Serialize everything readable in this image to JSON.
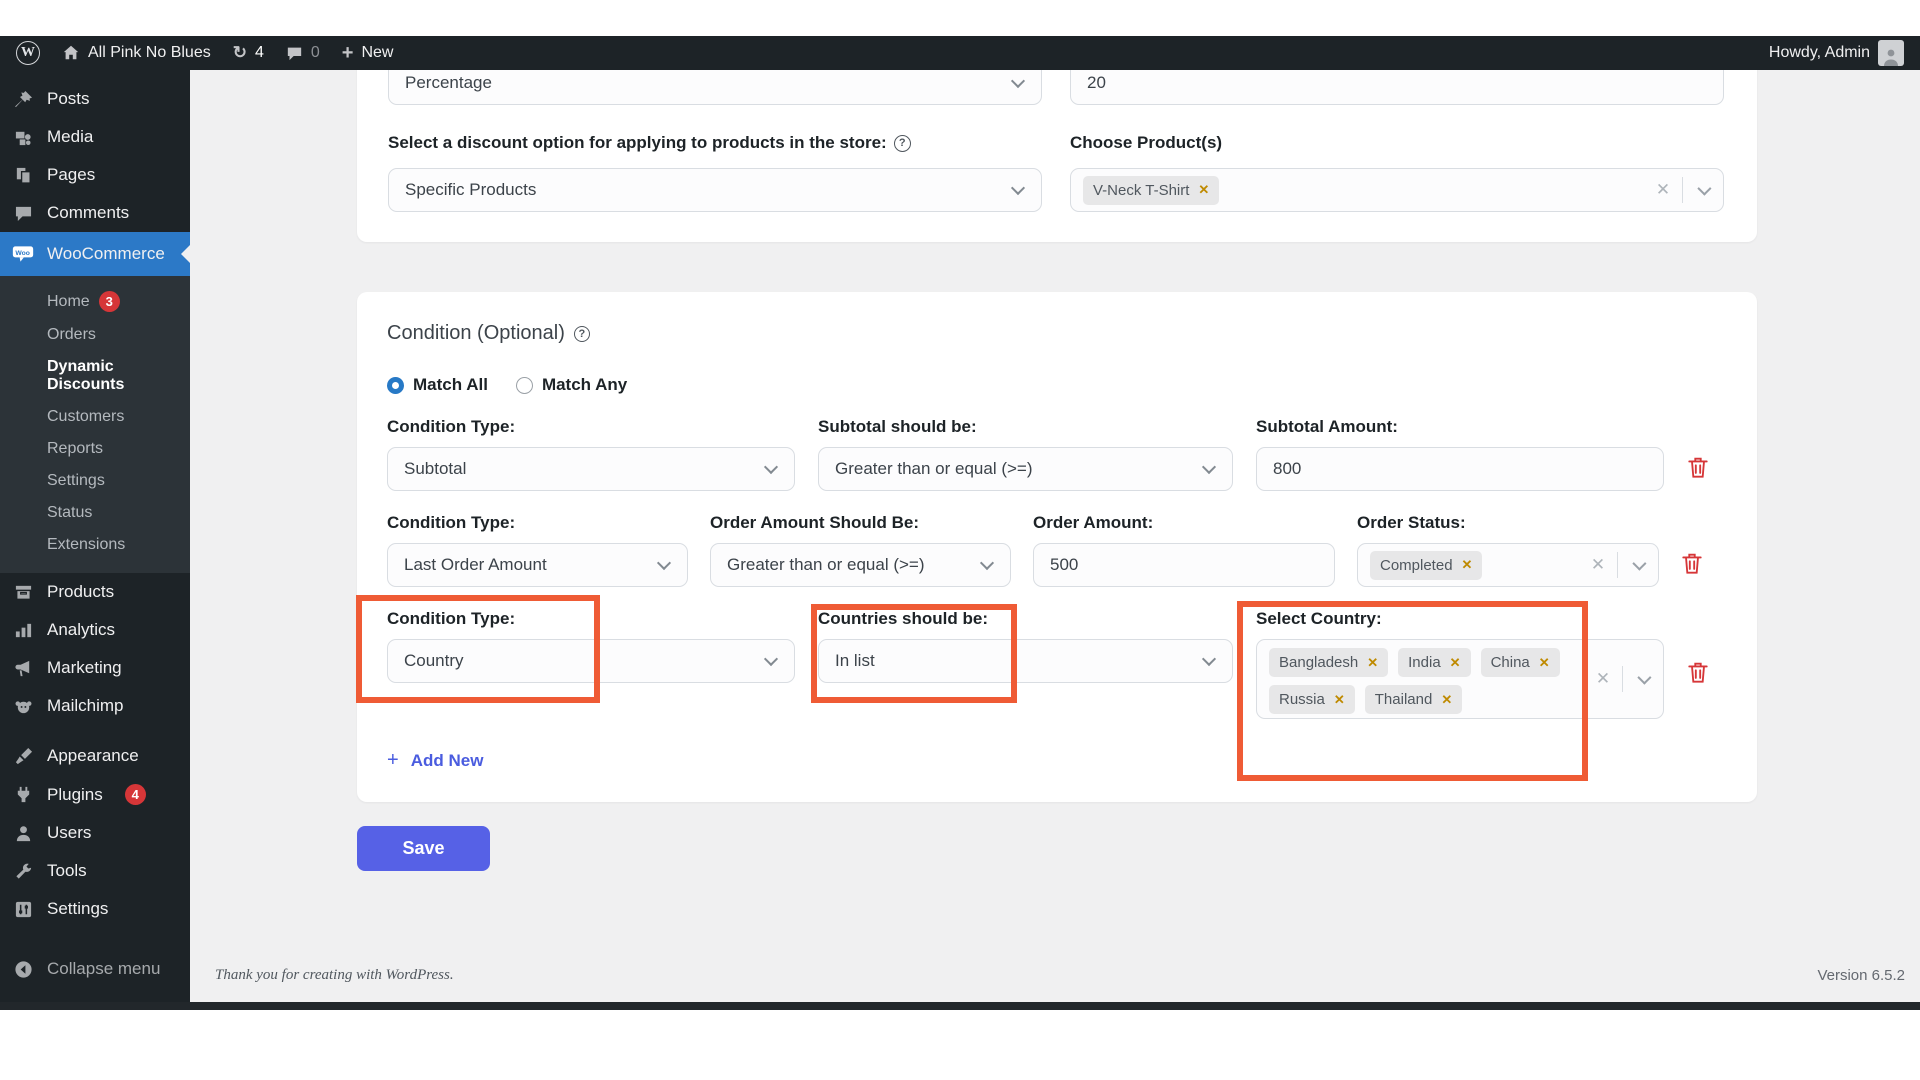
{
  "admin_bar": {
    "site_name": "All Pink No Blues",
    "updates_count": "4",
    "comments_count": "0",
    "new_label": "New",
    "howdy": "Howdy, Admin"
  },
  "sidebar": {
    "top_items": [
      {
        "label": "Posts"
      },
      {
        "label": "Media"
      },
      {
        "label": "Pages"
      },
      {
        "label": "Comments"
      }
    ],
    "woocommerce_label": "WooCommerce",
    "woo_submenu": [
      {
        "label": "Home",
        "badge": "3"
      },
      {
        "label": "Orders"
      },
      {
        "label": "Dynamic Discounts"
      },
      {
        "label": "Customers"
      },
      {
        "label": "Reports"
      },
      {
        "label": "Settings"
      },
      {
        "label": "Status"
      },
      {
        "label": "Extensions"
      }
    ],
    "bottom_items": [
      {
        "label": "Products"
      },
      {
        "label": "Analytics"
      },
      {
        "label": "Marketing"
      },
      {
        "label": "Mailchimp"
      },
      {
        "label": "Appearance"
      },
      {
        "label": "Plugins",
        "badge": "4"
      },
      {
        "label": "Users"
      },
      {
        "label": "Tools"
      },
      {
        "label": "Settings"
      }
    ],
    "collapse_label": "Collapse menu"
  },
  "discount_card": {
    "type_value": "Percentage",
    "amount_value": "20",
    "option_label": "Select a discount option for applying to products in the store:",
    "option_value": "Specific Products",
    "products_label": "Choose Product(s)",
    "product_tag": "V-Neck T-Shirt"
  },
  "condition_card": {
    "title": "Condition (Optional)",
    "match_all_label": "Match All",
    "match_any_label": "Match Any",
    "rows": [
      {
        "type_label": "Condition Type:",
        "type_value": "Subtotal",
        "op_label": "Subtotal should be:",
        "op_value": "Greater than or equal (>=)",
        "amount_label": "Subtotal Amount:",
        "amount_value": "800"
      },
      {
        "type_label": "Condition Type:",
        "type_value": "Last Order Amount",
        "op_label": "Order Amount Should Be:",
        "op_value": "Greater than or equal (>=)",
        "amount_label": "Order Amount:",
        "amount_value": "500",
        "status_label": "Order Status:",
        "status_tag": "Completed"
      },
      {
        "type_label": "Condition Type:",
        "type_value": "Country",
        "op_label": "Countries should be:",
        "op_value": "In list",
        "select_label": "Select Country:",
        "country_tags": [
          "Bangladesh",
          "India",
          "China",
          "Russia",
          "Thailand"
        ]
      }
    ],
    "add_new_label": "Add New"
  },
  "save_label": "Save",
  "footer": {
    "thanks": "Thank you for creating with WordPress.",
    "version": "Version 6.5.2"
  },
  "colors": {
    "active_menu_blue": "#2c79c7",
    "indigo_accent": "#5661e6",
    "highlight_orange": "#ef5b35",
    "badge_red": "#d63638",
    "tag_close_amber": "#bf8a00"
  }
}
